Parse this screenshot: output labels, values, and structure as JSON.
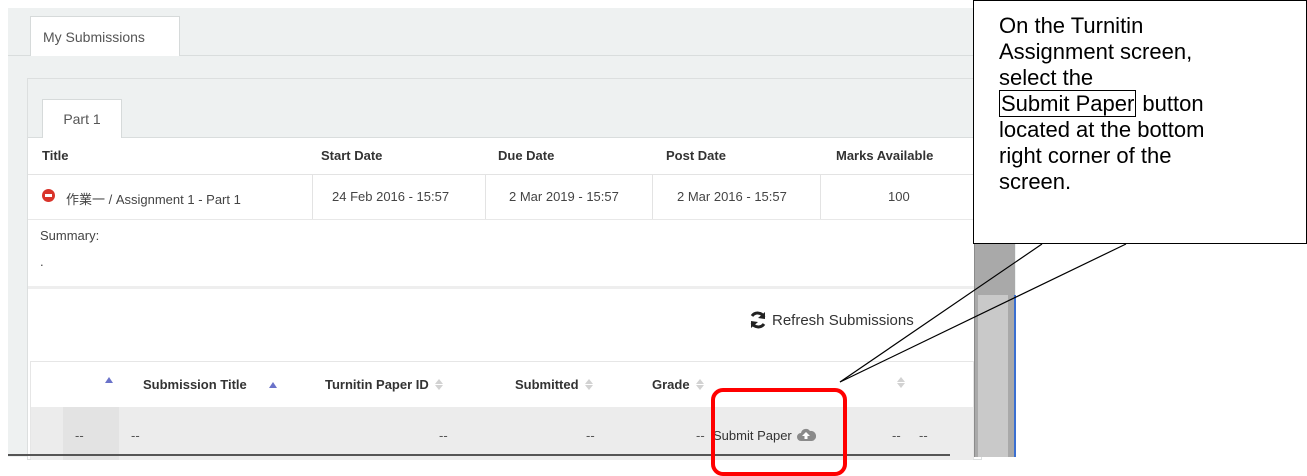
{
  "tabs": {
    "my_submissions": "My Submissions",
    "part_1": "Part 1"
  },
  "assignment_table": {
    "headers": [
      "Title",
      "Start Date",
      "Due Date",
      "Post Date",
      "Marks Available"
    ],
    "row": {
      "title": "作業一 / Assignment 1 - Part 1",
      "start_date": "24 Feb 2016 - 15:57",
      "due_date": "2 Mar 2019 - 15:57",
      "post_date": "2 Mar 2016 - 15:57",
      "marks_available": "100"
    },
    "summary_label": "Summary:",
    "summary_value": "."
  },
  "refresh": {
    "label": "Refresh Submissions"
  },
  "submissions_table": {
    "headers": {
      "submission_title": "Submission Title",
      "turnitin_paper_id": "Turnitin Paper ID",
      "submitted": "Submitted",
      "grade": "Grade"
    },
    "row": {
      "col_first": "--",
      "submission_title": "--",
      "turnitin_paper_id": "--",
      "submitted": "--",
      "grade": "--",
      "submit_paper": "Submit Paper",
      "col_last_a": "--",
      "col_last_b": "--"
    }
  },
  "callout": {
    "line1": "On the Turnitin",
    "line2": "Assignment screen,",
    "line3": "select the",
    "line4_boxed": "Submit Paper",
    "line4_rest": " button",
    "line5": "located at the bottom",
    "line6": "right corner of the",
    "line7": "screen."
  },
  "colors": {
    "remove_icon": "#d9342b",
    "sort_active": "#6a72c9",
    "highlight": "#ff0000",
    "scroll_accent": "#3a6fd1"
  },
  "icons": {
    "remove": "remove-circle-icon",
    "refresh": "refresh-icon",
    "upload": "cloud-upload-icon"
  }
}
